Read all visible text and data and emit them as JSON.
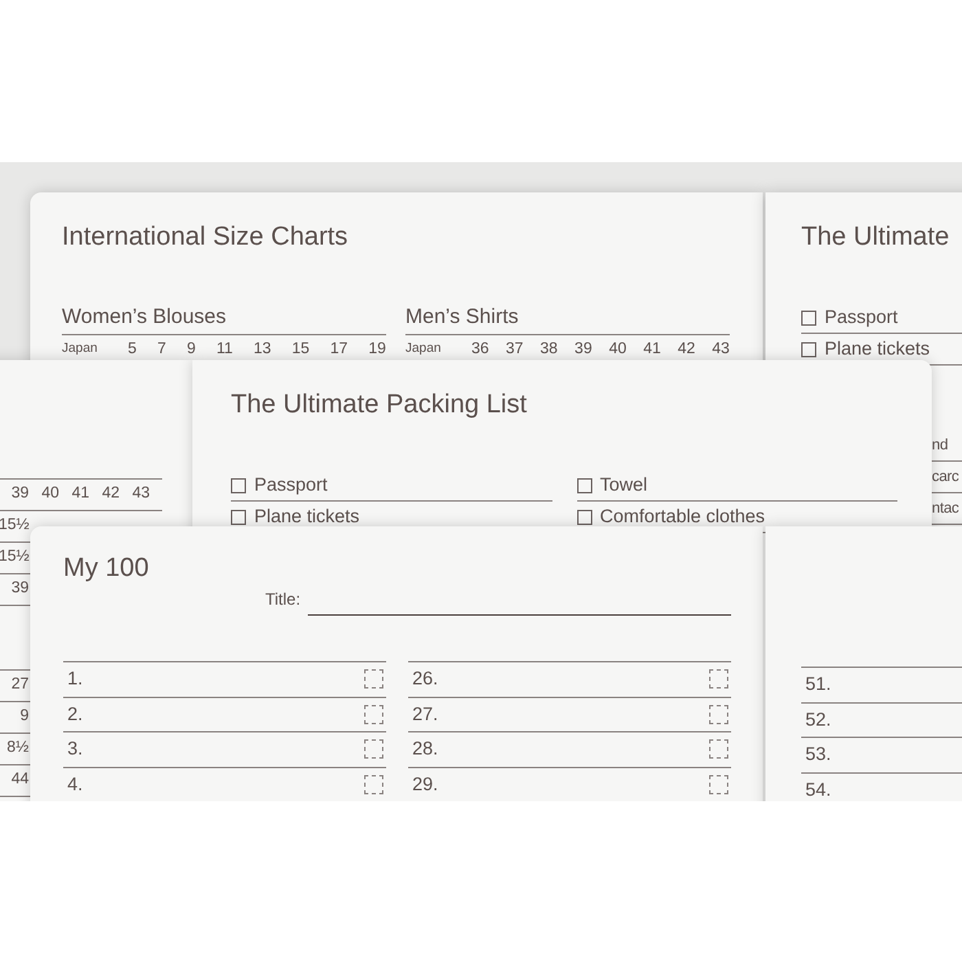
{
  "size_chart_page": {
    "title": "International Size Charts",
    "tables": [
      {
        "heading": "Women’s Blouses",
        "row_label": "Japan",
        "values": [
          "5",
          "7",
          "9",
          "11",
          "13",
          "15",
          "17",
          "19"
        ]
      },
      {
        "heading": "Men’s Shirts",
        "row_label": "Japan",
        "values": [
          "36",
          "37",
          "38",
          "39",
          "40",
          "41",
          "42",
          "43"
        ]
      }
    ]
  },
  "packing_peek_page": {
    "title": "The Ultimate",
    "items": [
      "Passport",
      "Plane tickets"
    ],
    "cut_fragments": [
      "nd",
      "carc",
      "ntac"
    ]
  },
  "size_chart_edge": {
    "rows_upper": [
      [
        "39",
        "40",
        "41",
        "42",
        "43"
      ],
      [
        "15½"
      ],
      [
        "15½"
      ],
      [
        "39"
      ]
    ],
    "rows_lower": [
      [
        "27"
      ],
      [
        "9"
      ],
      [
        "8½"
      ],
      [
        "44"
      ]
    ]
  },
  "packing_list_page": {
    "title": "The Ultimate Packing List",
    "columns": [
      [
        "Passport",
        "Plane tickets"
      ],
      [
        "Towel",
        "Comfortable clothes"
      ]
    ]
  },
  "my100_page": {
    "title": "My 100",
    "title_field_label": "Title:",
    "columns": [
      [
        "1.",
        "2.",
        "3.",
        "4."
      ],
      [
        "26.",
        "27.",
        "28.",
        "29."
      ]
    ]
  },
  "my100_next_page": {
    "items": [
      "51.",
      "52.",
      "53.",
      "54."
    ]
  }
}
